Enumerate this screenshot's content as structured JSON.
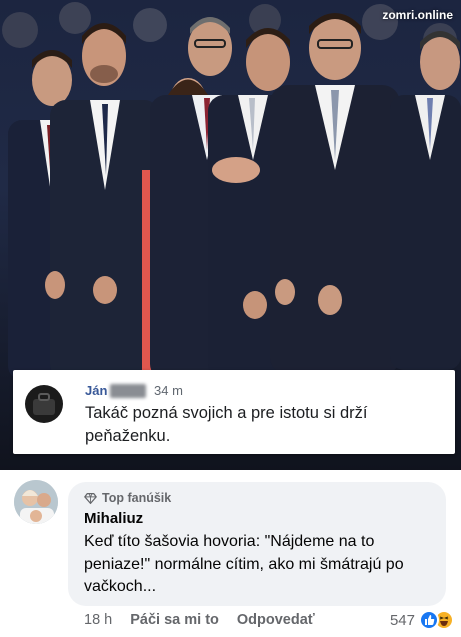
{
  "photo": {
    "watermark": "zomri.online",
    "embedded_comment": {
      "author": "Ján",
      "time": "34 m",
      "text": "Takáč pozná svojich a pre istotu si drží peňaženku."
    }
  },
  "comment": {
    "badge": "Top fanúšik",
    "author": "Mihaliuz",
    "text": "Keď títo šašovia hovoria: \"Nájdeme na to peniaze!\" normálne cítim, ako mi šmátrajú po vačkoch...",
    "time": "18 h",
    "like_label": "Páči sa mi to",
    "reply_label": "Odpovedať",
    "reaction_count": "547",
    "reaction_icons": [
      "like-icon",
      "haha-icon"
    ],
    "colors": {
      "like": "#1877f2",
      "haha": "#f7b125",
      "name_link": "#385898"
    }
  }
}
